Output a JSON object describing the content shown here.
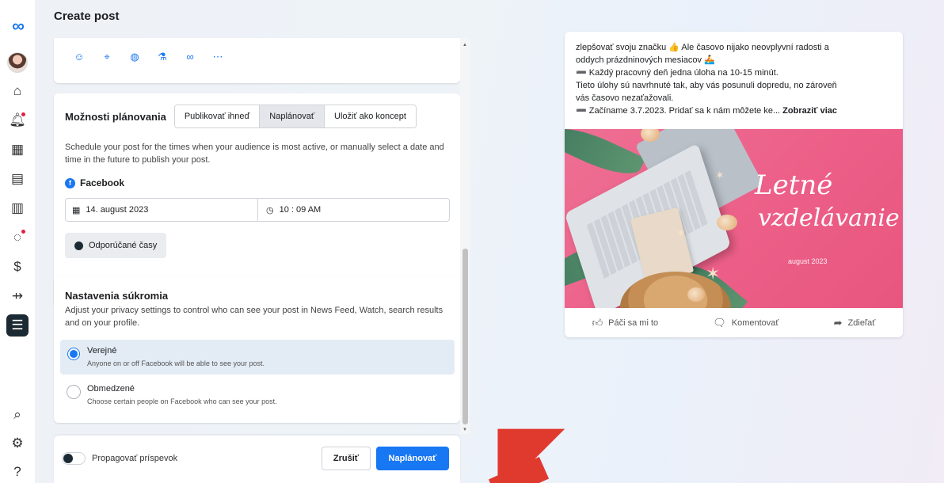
{
  "page": {
    "title": "Create post"
  },
  "nav": {
    "logo_icon": "meta-logo",
    "items": [
      {
        "name": "home-icon",
        "glyph": "⌂"
      },
      {
        "name": "notifications-icon",
        "glyph": "🔔︎",
        "badge": true
      },
      {
        "name": "content-icon",
        "glyph": "▦"
      },
      {
        "name": "planner-icon",
        "glyph": "▤"
      },
      {
        "name": "insights-icon",
        "glyph": "▥"
      },
      {
        "name": "inbox-icon",
        "glyph": "◌",
        "badge": true
      },
      {
        "name": "monetization-icon",
        "glyph": "$"
      },
      {
        "name": "ads-icon",
        "glyph": "⇸"
      },
      {
        "name": "menu-icon",
        "glyph": "☰",
        "active": true
      }
    ],
    "bottom": [
      {
        "name": "search-icon",
        "glyph": "⌕"
      },
      {
        "name": "settings-icon",
        "glyph": "⚙"
      },
      {
        "name": "help-icon",
        "glyph": "?"
      }
    ]
  },
  "composer_icons": [
    {
      "name": "emoji-icon",
      "glyph": "☺"
    },
    {
      "name": "location-icon",
      "glyph": "⌖"
    },
    {
      "name": "messenger-icon",
      "glyph": "◍"
    },
    {
      "name": "beaker-icon",
      "glyph": "⚗"
    },
    {
      "name": "link-icon",
      "glyph": "∞"
    },
    {
      "name": "more-icon",
      "glyph": "⋯"
    }
  ],
  "scheduling": {
    "title": "Možnosti plánovania",
    "tabs": [
      {
        "label": "Publikovať ihneď",
        "selected": false
      },
      {
        "label": "Naplánovať",
        "selected": true
      },
      {
        "label": "Uložiť ako koncept",
        "selected": false
      }
    ],
    "description": "Schedule your post for the times when your audience is most active, or manually select a date and time in the future to publish your post.",
    "platform": "Facebook",
    "date": "14. august 2023",
    "time": "10 : 09 AM",
    "recommended_button": "Odporúčané časy"
  },
  "privacy": {
    "title": "Nastavenia súkromia",
    "description": "Adjust your privacy settings to control who can see your post in News Feed, Watch, search results and on your profile.",
    "options": [
      {
        "label": "Verejné",
        "sub": "Anyone on or off Facebook will be able to see your post.",
        "checked": true
      },
      {
        "label": "Obmedzené",
        "sub": "Choose certain people on Facebook who can see your post.",
        "checked": false
      }
    ]
  },
  "footer": {
    "promote_label": "Propagovať príspevok",
    "promote_on": false,
    "cancel_label": "Zrušiť",
    "submit_label": "Naplánovať"
  },
  "preview": {
    "text_lines": [
      "zlepšovať svoju značku 👍 Ale časovo nijako neovplyvní radosti a",
      "oddych prázdninových mesiacov 🚣",
      "➖ Každý pracovný deň jedna úloha na 10-15 minút.",
      "Tieto úlohy sú navrhnuté tak, aby vás posunuli dopredu, no zároveň",
      "vás časovo nezaťažovali."
    ],
    "last_line": "➖ Začíname 3.7.2023. Pridať sa k nám môžete ke...",
    "see_more": "Zobraziť viac",
    "image_title_1": "Letné",
    "image_title_2": "vzdelávanie",
    "image_subtitle": "august 2023",
    "actions": [
      {
        "name": "like",
        "icon": "👍︎",
        "label": "Páči sa mi to"
      },
      {
        "name": "comment",
        "icon": "🗨︎",
        "label": "Komentovať"
      },
      {
        "name": "share",
        "icon": "➦",
        "label": "Zdieľať"
      }
    ]
  },
  "colors": {
    "accent": "#1877f2",
    "annotation_arrow": "#e03a2f",
    "image_bg": "#ec5f88"
  }
}
